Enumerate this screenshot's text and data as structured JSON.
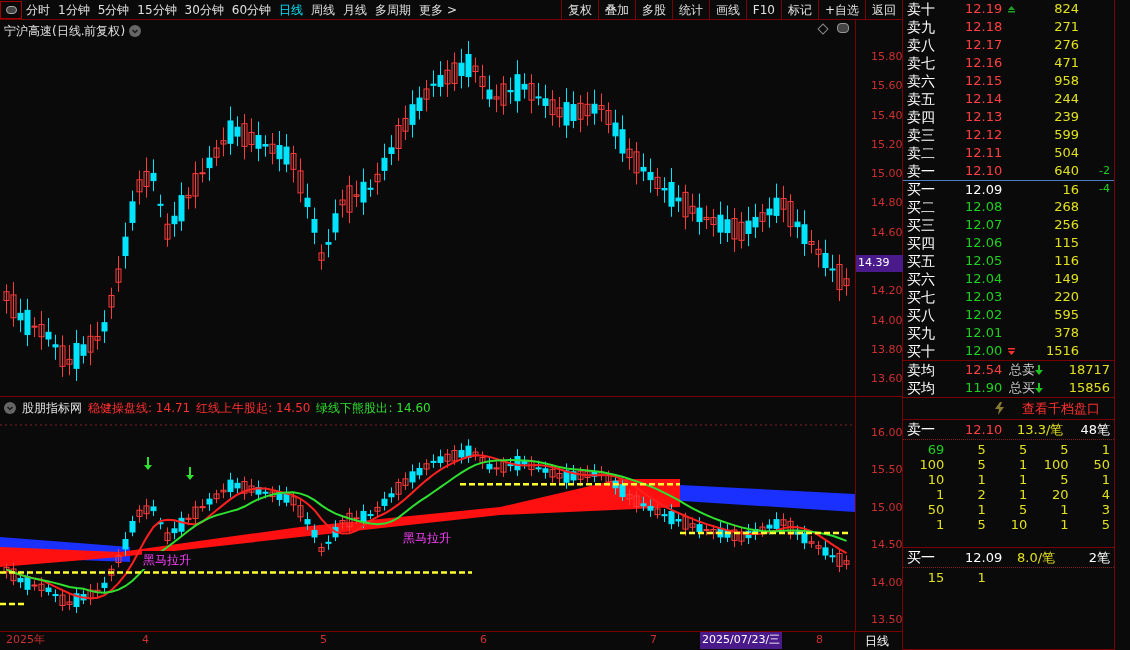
{
  "toolbar": {
    "periods": [
      {
        "label": "分时",
        "selected": false
      },
      {
        "label": "1分钟",
        "selected": false
      },
      {
        "label": "5分钟",
        "selected": false
      },
      {
        "label": "15分钟",
        "selected": false
      },
      {
        "label": "30分钟",
        "selected": false
      },
      {
        "label": "60分钟",
        "selected": false
      },
      {
        "label": "日线",
        "selected": true
      },
      {
        "label": "周线",
        "selected": false
      },
      {
        "label": "月线",
        "selected": false
      },
      {
        "label": "多周期",
        "selected": false
      },
      {
        "label": "更多 >",
        "selected": false
      }
    ],
    "buttons": [
      "复权",
      "叠加",
      "多股",
      "统计",
      "画线",
      "F10",
      "标记",
      "+自选",
      "返回"
    ]
  },
  "main_chart": {
    "title": "宁沪高速(日线.前复权)",
    "yticks": [
      "15.80",
      "15.60",
      "15.40",
      "15.20",
      "15.00",
      "14.80",
      "14.60",
      "14.20",
      "14.00",
      "13.80",
      "13.60"
    ],
    "current_price": "14.39"
  },
  "indicator": {
    "name": "股朋指标网",
    "values": [
      {
        "text": "稳健操盘线: 14.71",
        "color": "#ff3030"
      },
      {
        "text": "红线上牛股起: 14.50",
        "color": "#ff3030"
      },
      {
        "text": "绿线下熊股出: 14.60",
        "color": "#30e030"
      }
    ],
    "yticks": [
      "16.00",
      "15.50",
      "15.00",
      "14.50",
      "14.00",
      "13.50"
    ],
    "signals": [
      "黑马拉升",
      "黑马拉升"
    ]
  },
  "date_axis": {
    "labels": [
      {
        "text": "2025年",
        "selected": false
      },
      {
        "text": "4",
        "selected": false
      },
      {
        "text": "5",
        "selected": false
      },
      {
        "text": "6",
        "selected": false
      },
      {
        "text": "7",
        "selected": false
      },
      {
        "text": "2025/07/23/三",
        "selected": true
      },
      {
        "text": "8",
        "selected": false
      }
    ],
    "period": "日线"
  },
  "order_book": {
    "asks": [
      {
        "label": "卖十",
        "price": "12.19",
        "volume": "824",
        "color": "#ff4040",
        "up_marker": true,
        "down_marker": false
      },
      {
        "label": "卖九",
        "price": "12.18",
        "volume": "271",
        "color": "#ff4040",
        "up_marker": false,
        "down_marker": false
      },
      {
        "label": "卖八",
        "price": "12.17",
        "volume": "276",
        "color": "#ff4040",
        "up_marker": false,
        "down_marker": false
      },
      {
        "label": "卖七",
        "price": "12.16",
        "volume": "471",
        "color": "#ff4040",
        "up_marker": false,
        "down_marker": false
      },
      {
        "label": "卖六",
        "price": "12.15",
        "volume": "958",
        "color": "#ff4040",
        "up_marker": false,
        "down_marker": false
      },
      {
        "label": "卖五",
        "price": "12.14",
        "volume": "244",
        "color": "#ff4040",
        "up_marker": false,
        "down_marker": false
      },
      {
        "label": "卖四",
        "price": "12.13",
        "volume": "239",
        "color": "#ff4040",
        "up_marker": false,
        "down_marker": false
      },
      {
        "label": "卖三",
        "price": "12.12",
        "volume": "599",
        "color": "#ff4040",
        "up_marker": false,
        "down_marker": false
      },
      {
        "label": "卖二",
        "price": "12.11",
        "volume": "504",
        "color": "#ff4040",
        "up_marker": false,
        "down_marker": false
      },
      {
        "label": "卖一",
        "price": "12.10",
        "volume": "640",
        "change": "-2",
        "color": "#ff4040",
        "up_marker": false,
        "down_marker": false
      }
    ],
    "bids": [
      {
        "label": "买一",
        "price": "12.09",
        "volume": "16",
        "change": "-4",
        "color": "#ffffff",
        "up_marker": false,
        "down_marker": false
      },
      {
        "label": "买二",
        "price": "12.08",
        "volume": "268",
        "color": "#20d020",
        "up_marker": false,
        "down_marker": false
      },
      {
        "label": "买三",
        "price": "12.07",
        "volume": "256",
        "color": "#20d020",
        "up_marker": false,
        "down_marker": false
      },
      {
        "label": "买四",
        "price": "12.06",
        "volume": "115",
        "color": "#20d020",
        "up_marker": false,
        "down_marker": false
      },
      {
        "label": "买五",
        "price": "12.05",
        "volume": "116",
        "color": "#20d020",
        "up_marker": false,
        "down_marker": false
      },
      {
        "label": "买六",
        "price": "12.04",
        "volume": "149",
        "color": "#20d020",
        "up_marker": false,
        "down_marker": false
      },
      {
        "label": "买七",
        "price": "12.03",
        "volume": "220",
        "color": "#20d020",
        "up_marker": false,
        "down_marker": false
      },
      {
        "label": "买八",
        "price": "12.02",
        "volume": "595",
        "color": "#20d020",
        "up_marker": false,
        "down_marker": false
      },
      {
        "label": "买九",
        "price": "12.01",
        "volume": "378",
        "color": "#20d020",
        "up_marker": false,
        "down_marker": false
      },
      {
        "label": "买十",
        "price": "12.00",
        "volume": "1516",
        "color": "#20d020",
        "up_marker": false,
        "down_marker": true
      }
    ],
    "summary": [
      {
        "label": "卖均",
        "price": "12.54",
        "color": "#ff4040",
        "total_label": "总卖",
        "total": "18717"
      },
      {
        "label": "买均",
        "price": "11.90",
        "color": "#20d020",
        "total_label": "总买",
        "total": "15856"
      }
    ]
  },
  "queue": {
    "link": "查看千档盘口",
    "sides": [
      {
        "label": "卖一",
        "price": "12.10",
        "color": "#ff4040",
        "avg": "13.3/笔",
        "count": "48笔",
        "rows": [
          {
            "cells": [
              "69",
              "5",
              "5",
              "5",
              "1"
            ],
            "lead_highlighted": true
          },
          {
            "cells": [
              "100",
              "5",
              "1",
              "100",
              "50"
            ],
            "lead_highlighted": false
          },
          {
            "cells": [
              "10",
              "1",
              "1",
              "5",
              "1"
            ],
            "lead_highlighted": false
          },
          {
            "cells": [
              "1",
              "2",
              "1",
              "20",
              "4"
            ],
            "lead_highlighted": false
          },
          {
            "cells": [
              "50",
              "1",
              "5",
              "1",
              "3"
            ],
            "lead_highlighted": false
          },
          {
            "cells": [
              "1",
              "5",
              "10",
              "1",
              "5"
            ],
            "lead_highlighted": false
          }
        ]
      },
      {
        "label": "买一",
        "price": "12.09",
        "color": "#ffffff",
        "avg": "8.0/笔",
        "count": "2笔",
        "rows": [
          {
            "cells": [
              "15",
              "1"
            ],
            "lead_highlighted": false
          }
        ]
      }
    ]
  }
}
